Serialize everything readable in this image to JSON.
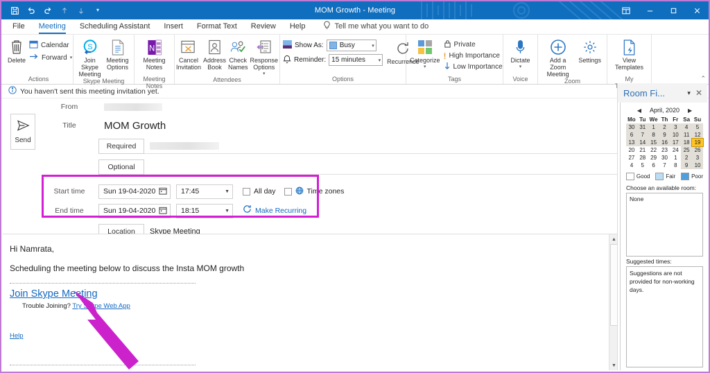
{
  "titlebar": {
    "document_title": "MOM Growth  -  Meeting",
    "quick_access": [
      {
        "name": "save-icon",
        "label": "Save"
      },
      {
        "name": "undo-icon",
        "label": "Undo"
      },
      {
        "name": "redo-icon",
        "label": "Redo"
      },
      {
        "name": "previous-item-icon",
        "label": "Previous Item"
      },
      {
        "name": "next-item-icon",
        "label": "Next Item"
      },
      {
        "name": "customize-quick-access-icon",
        "label": "Customize Quick Access Toolbar"
      }
    ],
    "window_controls": {
      "ribbon_display": "Ribbon Display Options",
      "minimize": "Minimize",
      "maximize": "Maximize",
      "close": "Close"
    }
  },
  "tabs": [
    {
      "label": "File",
      "active": false
    },
    {
      "label": "Meeting",
      "active": true
    },
    {
      "label": "Scheduling Assistant",
      "active": false
    },
    {
      "label": "Insert",
      "active": false
    },
    {
      "label": "Format Text",
      "active": false
    },
    {
      "label": "Review",
      "active": false
    },
    {
      "label": "Help",
      "active": false
    }
  ],
  "tell_me": {
    "label": "Tell me what you want to do",
    "icon": "lightbulb-icon"
  },
  "ribbon": {
    "groups": [
      {
        "label": "Actions",
        "buttons": [
          {
            "label": "Delete",
            "icon": "trash-icon"
          },
          {
            "label": "Calendar",
            "icon": "calendar-icon"
          },
          {
            "label": "Forward",
            "icon": "forward-arrow-icon"
          }
        ]
      },
      {
        "label": "Skype Meeting",
        "buttons": [
          {
            "label": "Join Skype Meeting",
            "icon": "skype-icon"
          },
          {
            "label": "Meeting Options",
            "icon": "meeting-options-icon"
          }
        ]
      },
      {
        "label": "Meeting Notes",
        "buttons": [
          {
            "label": "Meeting Notes",
            "icon": "onenote-icon"
          }
        ]
      },
      {
        "label": "Attendees",
        "buttons": [
          {
            "label": "Cancel Invitation",
            "icon": "cancel-invitation-icon"
          },
          {
            "label": "Address Book",
            "icon": "address-book-icon"
          },
          {
            "label": "Check Names",
            "icon": "check-names-icon"
          },
          {
            "label": "Response Options",
            "icon": "response-options-icon"
          }
        ]
      },
      {
        "label": "Options",
        "show_as_label": "Show As:",
        "show_as_value": "Busy",
        "reminder_label": "Reminder:",
        "reminder_value": "15 minutes",
        "recurrence_label": "Recurrence"
      },
      {
        "label": "Tags",
        "categorize_label": "Categorize",
        "private_label": "Private",
        "high_importance_label": "High Importance",
        "low_importance_label": "Low Importance"
      },
      {
        "label": "Voice",
        "buttons": [
          {
            "label": "Dictate",
            "icon": "microphone-icon"
          }
        ]
      },
      {
        "label": "Zoom",
        "buttons": [
          {
            "label": "Add a Zoom Meeting",
            "icon": "zoom-plus-icon"
          },
          {
            "label": "Settings",
            "icon": "gear-icon"
          }
        ]
      },
      {
        "label": "My Templates",
        "buttons": [
          {
            "label": "View Templates",
            "icon": "templates-icon"
          }
        ]
      }
    ]
  },
  "info_bar": {
    "icon": "info-icon",
    "message": "You haven't sent this meeting invitation yet."
  },
  "form": {
    "send_label": "Send",
    "from_label": "From",
    "from_value": "",
    "title_label": "Title",
    "title_value": "MOM Growth",
    "required_label": "Required",
    "required_value": "",
    "optional_label": "Optional",
    "optional_value": "",
    "start_time_label": "Start time",
    "start_date_value": "Sun 19-04-2020",
    "start_time_value": "17:45",
    "end_time_label": "End time",
    "end_date_value": "Sun 19-04-2020",
    "end_time_value": "18:15",
    "all_day_label": "All day",
    "time_zones_label": "Time zones",
    "make_recurring_label": "Make Recurring",
    "location_label": "Location",
    "location_value": "Skype Meeting",
    "room_finder_label": "Room Finder"
  },
  "body": {
    "greeting": "Hi Namrata,",
    "paragraph": "Scheduling the meeting below to discuss the Insta MOM growth",
    "join_link": "Join Skype Meeting",
    "trouble_prefix": "Trouble Joining?",
    "trouble_link": "Try Skype Web App",
    "help_link": "Help"
  },
  "room_finder": {
    "title": "Room Fi...",
    "month_label": "April, 2020",
    "prev_label": "Previous month",
    "next_label": "Next month",
    "weekdays": [
      "Mo",
      "Tu",
      "We",
      "Th",
      "Fr",
      "Sa",
      "Su"
    ],
    "weeks": [
      [
        {
          "d": "30",
          "s": "out shade"
        },
        {
          "d": "31",
          "s": "out shade"
        },
        {
          "d": "1",
          "s": "shade"
        },
        {
          "d": "2",
          "s": "shade"
        },
        {
          "d": "3",
          "s": "shade"
        },
        {
          "d": "4",
          "s": "shade"
        },
        {
          "d": "5",
          "s": "shade"
        }
      ],
      [
        {
          "d": "6",
          "s": "shade"
        },
        {
          "d": "7",
          "s": "shade"
        },
        {
          "d": "8",
          "s": "shade"
        },
        {
          "d": "9",
          "s": "shade"
        },
        {
          "d": "10",
          "s": "shade"
        },
        {
          "d": "11",
          "s": "shade"
        },
        {
          "d": "12",
          "s": "shade"
        }
      ],
      [
        {
          "d": "13",
          "s": "shade"
        },
        {
          "d": "14",
          "s": "shade"
        },
        {
          "d": "15",
          "s": "shade"
        },
        {
          "d": "16",
          "s": "shade"
        },
        {
          "d": "17",
          "s": "shade"
        },
        {
          "d": "18",
          "s": "shade"
        },
        {
          "d": "19",
          "s": "sel"
        }
      ],
      [
        {
          "d": "20",
          "s": ""
        },
        {
          "d": "21",
          "s": ""
        },
        {
          "d": "22",
          "s": ""
        },
        {
          "d": "23",
          "s": ""
        },
        {
          "d": "24",
          "s": ""
        },
        {
          "d": "25",
          "s": "shade"
        },
        {
          "d": "26",
          "s": "shade"
        }
      ],
      [
        {
          "d": "27",
          "s": ""
        },
        {
          "d": "28",
          "s": ""
        },
        {
          "d": "29",
          "s": ""
        },
        {
          "d": "30",
          "s": ""
        },
        {
          "d": "1",
          "s": "out"
        },
        {
          "d": "2",
          "s": "out shade"
        },
        {
          "d": "3",
          "s": "out shade"
        }
      ],
      [
        {
          "d": "4",
          "s": "out"
        },
        {
          "d": "5",
          "s": "out"
        },
        {
          "d": "6",
          "s": "out"
        },
        {
          "d": "7",
          "s": "out"
        },
        {
          "d": "8",
          "s": "out"
        },
        {
          "d": "9",
          "s": "out shade"
        },
        {
          "d": "10",
          "s": "out shade"
        }
      ]
    ],
    "legend": [
      {
        "label": "Good",
        "color": "#ffffff"
      },
      {
        "label": "Fair",
        "color": "#bcdcf4"
      },
      {
        "label": "Poor",
        "color": "#4e9fe0"
      }
    ],
    "choose_room_label": "Choose an available room:",
    "room_list_value": "None",
    "suggested_times_label": "Suggested times:",
    "suggestions_text": "Suggestions are not provided for non-working days."
  },
  "annotation": {
    "arrow_color": "#cc22cc",
    "highlight_box_color": "#d41fd4"
  }
}
